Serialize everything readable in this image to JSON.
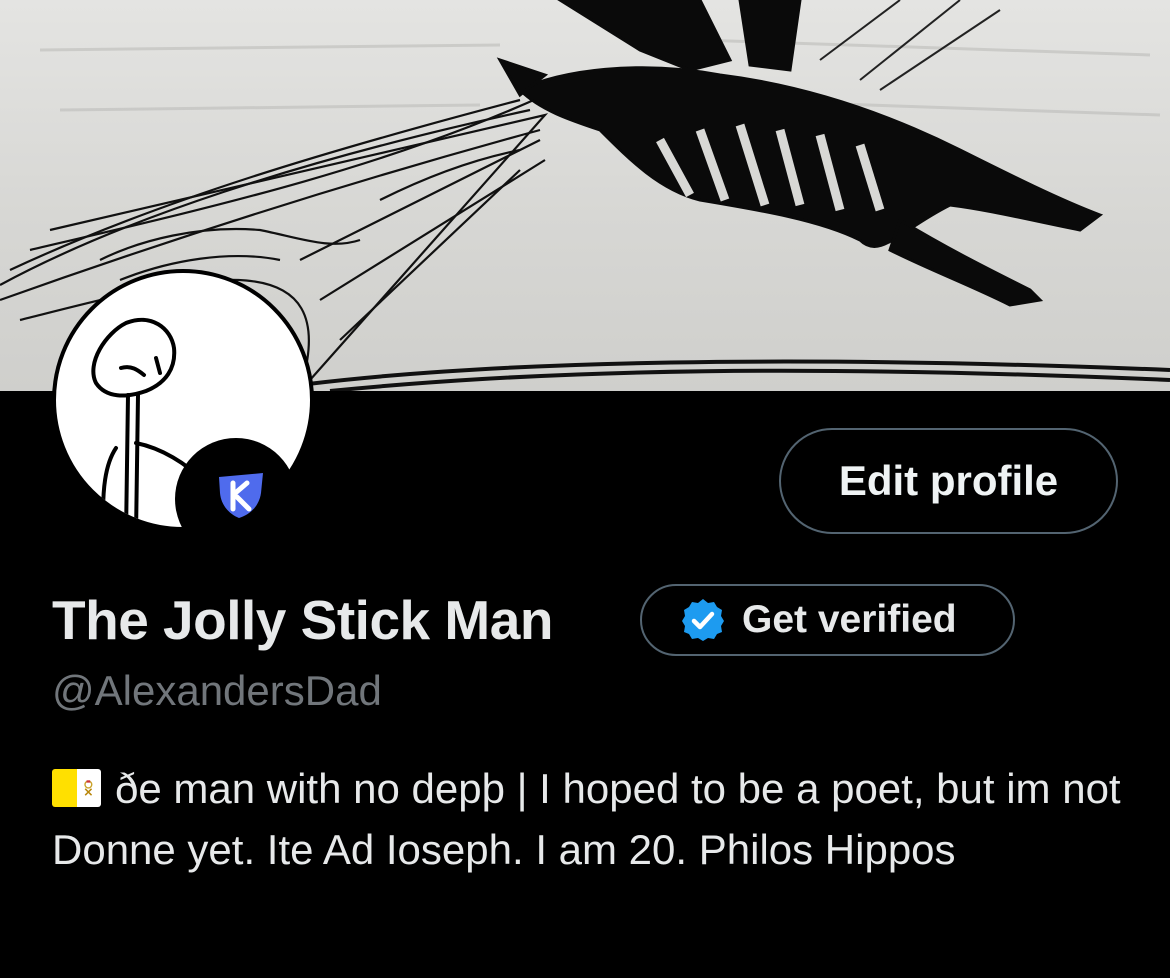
{
  "banner": {
    "description_icon": "stick-figure-drawing-banner"
  },
  "avatar": {
    "icon": "stick-figure-avatar",
    "badge_icon": "community-badge-icon"
  },
  "actions": {
    "edit_profile_label": "Edit profile"
  },
  "profile": {
    "display_name": "The Jolly Stick Man",
    "get_verified_label": "Get verified",
    "handle": "@AlexandersDad",
    "bio_flag_icon": "vatican-flag-icon",
    "bio_text": "ðe man with no depþ | I hoped to be a poet, but im not Donne yet. Ite Ad Ioseph. I am 20. Philos Hippos"
  },
  "colors": {
    "background": "#000000",
    "text_primary": "#e7e9ea",
    "text_secondary": "#71767b",
    "button_border": "#536471",
    "verified_blue": "#1d9bf0",
    "badge_blue": "#4f6bed"
  }
}
